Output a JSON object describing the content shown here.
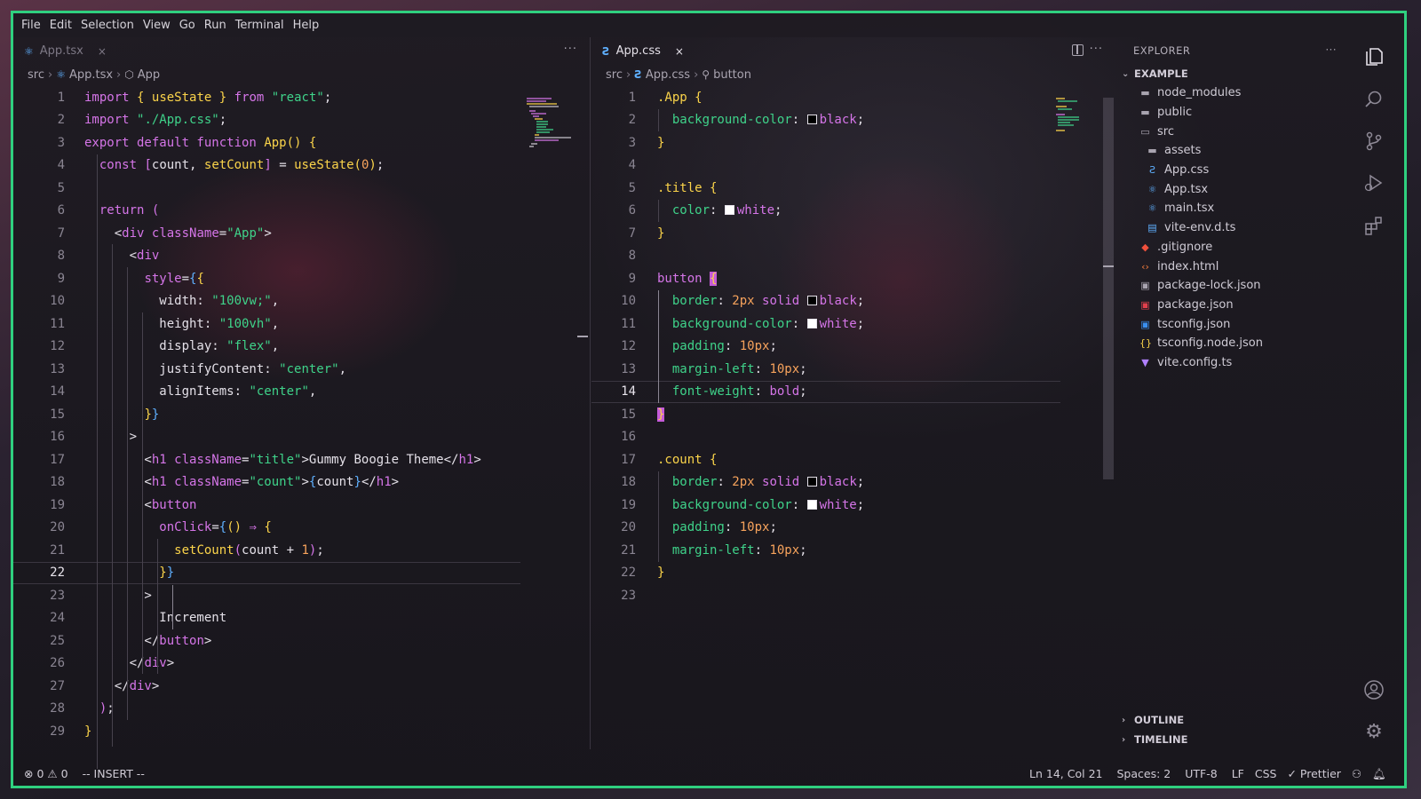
{
  "menu": [
    "File",
    "Edit",
    "Selection",
    "View",
    "Go",
    "Run",
    "Terminal",
    "Help"
  ],
  "left_editor": {
    "tab": {
      "label": "App.tsx",
      "close": "×"
    },
    "more": "···",
    "breadcrumb": {
      "folder": "src",
      "file": "App.tsx",
      "symbol": "App"
    },
    "current_line": 22
  },
  "right_editor": {
    "tab": {
      "label": "App.css",
      "close": "×"
    },
    "more": "···",
    "breadcrumb": {
      "folder": "src",
      "file": "App.css",
      "symbol": "button"
    },
    "current_line": 14
  },
  "explorer": {
    "title": "EXPLORER",
    "more": "···",
    "root": "EXAMPLE",
    "items": [
      {
        "name": "node_modules",
        "icon": "folder-icon",
        "depth": 0
      },
      {
        "name": "public",
        "icon": "folder-icon",
        "depth": 0
      },
      {
        "name": "src",
        "icon": "folder-open-icon",
        "depth": 0
      },
      {
        "name": "assets",
        "icon": "folder-icon",
        "depth": 1
      },
      {
        "name": "App.css",
        "icon": "css-file-icon",
        "depth": 1
      },
      {
        "name": "App.tsx",
        "icon": "react-file-icon",
        "depth": 1
      },
      {
        "name": "main.tsx",
        "icon": "react-file-icon",
        "depth": 1
      },
      {
        "name": "vite-env.d.ts",
        "icon": "ts-file-icon",
        "depth": 1
      },
      {
        "name": ".gitignore",
        "icon": "git-file-icon",
        "depth": 0
      },
      {
        "name": "index.html",
        "icon": "html-file-icon",
        "depth": 0
      },
      {
        "name": "package-lock.json",
        "icon": "lock-file-icon",
        "depth": 0
      },
      {
        "name": "package.json",
        "icon": "npm-file-icon",
        "depth": 0
      },
      {
        "name": "tsconfig.json",
        "icon": "ts-config-icon",
        "depth": 0
      },
      {
        "name": "tsconfig.node.json",
        "icon": "json-file-icon",
        "depth": 0
      },
      {
        "name": "vite.config.ts",
        "icon": "vite-file-icon",
        "depth": 0
      }
    ],
    "outline": "OUTLINE",
    "timeline": "TIMELINE"
  },
  "status": {
    "errors": "0",
    "warnings": "0",
    "mode": "-- INSERT --",
    "position": "Ln 14, Col 21",
    "spaces": "Spaces: 2",
    "encoding": "UTF-8",
    "eol": "LF",
    "language": "CSS",
    "formatter": "Prettier"
  },
  "colors": {
    "frame_border": "#2fd07f",
    "keyword": "#d575e8",
    "function": "#fbd44a",
    "string": "#3fd38a",
    "number": "#f7a35c"
  }
}
